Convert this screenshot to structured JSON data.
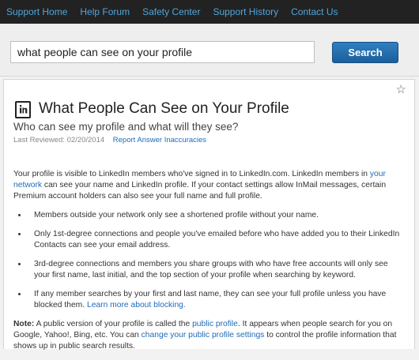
{
  "topnav": {
    "items": [
      "Support Home",
      "Help Forum",
      "Safety Center",
      "Support History",
      "Contact Us"
    ]
  },
  "search": {
    "value": "what people can see on your profile",
    "button_label": "Search"
  },
  "article": {
    "title": "What People Can See on Your Profile",
    "subtitle": "Who can see my profile and what will they see?",
    "last_reviewed": "Last Reviewed: 02/20/2014",
    "report_link": "Report Answer Inaccuracies",
    "intro": {
      "text1": "Your profile is visible to LinkedIn members who've signed in to LinkedIn.com. LinkedIn members in ",
      "link": "your network",
      "text2": " can see your name and LinkedIn profile. If your contact settings allow InMail messages, certain Premium account holders can also see your full name and full profile."
    },
    "bullets": {
      "b1": "Members outside your network only see a shortened profile without your name.",
      "b2": "Only 1st-degree connections and people you've emailed before who have added you to their LinkedIn Contacts can see your email address.",
      "b3": "3rd-degree connections and members you share groups with who have free accounts will only see your first name, last initial, and the top section of your profile when searching by keyword.",
      "b4_text": "If any member searches by your first and last name, they can see your full profile unless you have blocked them. ",
      "b4_link": "Learn more about blocking."
    },
    "note": {
      "label": "Note:",
      "text1": " A public version of your profile is called the ",
      "link1": "public profile",
      "text2": ". It appears when people search for you on Google, Yahoo!, Bing, etc. You can ",
      "link2": "change your public profile settings",
      "text3": " to control the profile information that shows up in public search results."
    }
  }
}
